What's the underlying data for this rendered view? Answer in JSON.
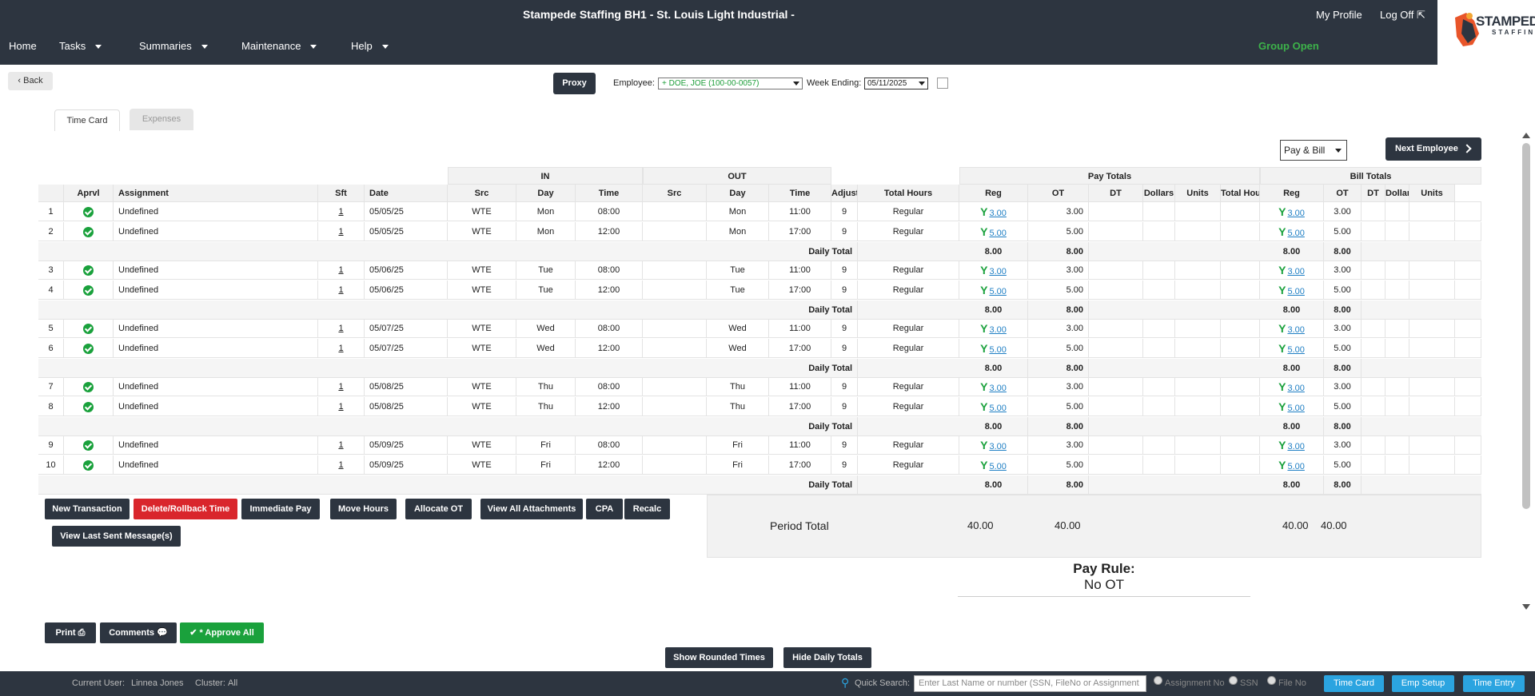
{
  "header": {
    "title": "Stampede Staffing BH1 - St. Louis Light Industrial -",
    "my_profile": "My Profile",
    "log_off": "Log Off",
    "logo_text": "STAMPEDE",
    "logo_sub": "STAFFING",
    "group_status": "Group Open",
    "nav": [
      "Home",
      "Tasks",
      "Summaries",
      "Maintenance",
      "Help"
    ]
  },
  "toolbar": {
    "back": "‹ Back",
    "proxy": "Proxy",
    "employee_label": "Employee:",
    "employee_value": "+  DOE, JOE (100-00-0057)",
    "week_label": "Week Ending:",
    "week_value": "05/11/2025"
  },
  "tabs": [
    "Time Card",
    "Expenses"
  ],
  "pay_bill_select": "Pay & Bill",
  "next_employee": "Next Employee",
  "table": {
    "group_headers": {
      "in": "IN",
      "out": "OUT",
      "pay_totals": "Pay Totals",
      "bill_totals": "Bill Totals"
    },
    "headers": [
      "",
      "Aprvl",
      "Assignment",
      "Sft",
      "Date",
      "Src",
      "Day",
      "Time",
      "Src",
      "Day",
      "Time",
      "Adjustment",
      "Total Hours",
      "Reg",
      "OT",
      "DT",
      "Dollars",
      "Units",
      "Total Hours",
      "Reg",
      "OT",
      "DT",
      "Dollars",
      "Units"
    ],
    "rows": [
      {
        "n": "1",
        "assign": "Undefined",
        "sft": "1",
        "date": "05/05/25",
        "in_src": "WTE",
        "in_day": "Mon",
        "in_time": "08:00",
        "out_src": "",
        "out_day": "Mon",
        "out_time": "11:00",
        "code": "9",
        "adj": "Regular",
        "pay_total": "3.00",
        "pay_reg": "3.00",
        "bill_total": "3.00",
        "bill_reg": "3.00"
      },
      {
        "n": "2",
        "assign": "Undefined",
        "sft": "1",
        "date": "05/05/25",
        "in_src": "WTE",
        "in_day": "Mon",
        "in_time": "12:00",
        "out_src": "",
        "out_day": "Mon",
        "out_time": "17:00",
        "code": "9",
        "adj": "Regular",
        "pay_total": "5.00",
        "pay_reg": "5.00",
        "bill_total": "5.00",
        "bill_reg": "5.00"
      },
      {
        "n": "3",
        "assign": "Undefined",
        "sft": "1",
        "date": "05/06/25",
        "in_src": "WTE",
        "in_day": "Tue",
        "in_time": "08:00",
        "out_src": "",
        "out_day": "Tue",
        "out_time": "11:00",
        "code": "9",
        "adj": "Regular",
        "pay_total": "3.00",
        "pay_reg": "3.00",
        "bill_total": "3.00",
        "bill_reg": "3.00"
      },
      {
        "n": "4",
        "assign": "Undefined",
        "sft": "1",
        "date": "05/06/25",
        "in_src": "WTE",
        "in_day": "Tue",
        "in_time": "12:00",
        "out_src": "",
        "out_day": "Tue",
        "out_time": "17:00",
        "code": "9",
        "adj": "Regular",
        "pay_total": "5.00",
        "pay_reg": "5.00",
        "bill_total": "5.00",
        "bill_reg": "5.00"
      },
      {
        "n": "5",
        "assign": "Undefined",
        "sft": "1",
        "date": "05/07/25",
        "in_src": "WTE",
        "in_day": "Wed",
        "in_time": "08:00",
        "out_src": "",
        "out_day": "Wed",
        "out_time": "11:00",
        "code": "9",
        "adj": "Regular",
        "pay_total": "3.00",
        "pay_reg": "3.00",
        "bill_total": "3.00",
        "bill_reg": "3.00"
      },
      {
        "n": "6",
        "assign": "Undefined",
        "sft": "1",
        "date": "05/07/25",
        "in_src": "WTE",
        "in_day": "Wed",
        "in_time": "12:00",
        "out_src": "",
        "out_day": "Wed",
        "out_time": "17:00",
        "code": "9",
        "adj": "Regular",
        "pay_total": "5.00",
        "pay_reg": "5.00",
        "bill_total": "5.00",
        "bill_reg": "5.00"
      },
      {
        "n": "7",
        "assign": "Undefined",
        "sft": "1",
        "date": "05/08/25",
        "in_src": "WTE",
        "in_day": "Thu",
        "in_time": "08:00",
        "out_src": "",
        "out_day": "Thu",
        "out_time": "11:00",
        "code": "9",
        "adj": "Regular",
        "pay_total": "3.00",
        "pay_reg": "3.00",
        "bill_total": "3.00",
        "bill_reg": "3.00"
      },
      {
        "n": "8",
        "assign": "Undefined",
        "sft": "1",
        "date": "05/08/25",
        "in_src": "WTE",
        "in_day": "Thu",
        "in_time": "12:00",
        "out_src": "",
        "out_day": "Thu",
        "out_time": "17:00",
        "code": "9",
        "adj": "Regular",
        "pay_total": "5.00",
        "pay_reg": "5.00",
        "bill_total": "5.00",
        "bill_reg": "5.00"
      },
      {
        "n": "9",
        "assign": "Undefined",
        "sft": "1",
        "date": "05/09/25",
        "in_src": "WTE",
        "in_day": "Fri",
        "in_time": "08:00",
        "out_src": "",
        "out_day": "Fri",
        "out_time": "11:00",
        "code": "9",
        "adj": "Regular",
        "pay_total": "3.00",
        "pay_reg": "3.00",
        "bill_total": "3.00",
        "bill_reg": "3.00"
      },
      {
        "n": "10",
        "assign": "Undefined",
        "sft": "1",
        "date": "05/09/25",
        "in_src": "WTE",
        "in_day": "Fri",
        "in_time": "12:00",
        "out_src": "",
        "out_day": "Fri",
        "out_time": "17:00",
        "code": "9",
        "adj": "Regular",
        "pay_total": "5.00",
        "pay_reg": "5.00",
        "bill_total": "5.00",
        "bill_reg": "5.00"
      }
    ],
    "daily_total_label": "Daily Total",
    "daily_total": {
      "pay_total": "8.00",
      "pay_reg": "8.00",
      "bill_total": "8.00",
      "bill_reg": "8.00"
    },
    "period_total_label": "Period Total",
    "period_total": {
      "pay_total": "40.00",
      "pay_reg": "40.00",
      "bill_total": "40.00",
      "bill_reg": "40.00"
    }
  },
  "actions": [
    "New Transaction",
    "Delete/Rollback Time",
    "Immediate Pay",
    "Move Hours",
    "Allocate OT",
    "View All Attachments",
    "CPA",
    "Recalc",
    "View Last Sent Message(s)"
  ],
  "pay_rule": {
    "label": "Pay Rule:",
    "value": "No OT"
  },
  "bottom_actions": {
    "print": "Print",
    "comments": "Comments",
    "approve_all": "* Approve All",
    "show_rounded": "Show Rounded Times",
    "hide_daily": "Hide Daily Totals"
  },
  "footer": {
    "current_user_label": "Current User:",
    "current_user": "Linnea Jones",
    "cluster_label": "Cluster:",
    "cluster": "All",
    "quick_search_label": "Quick Search:",
    "quick_search_placeholder": "Enter Last Name or number (SSN, FileNo or Assignment",
    "radio_assignment": "Assignment No",
    "radio_ssn": "SSN",
    "radio_file": "File No",
    "btn_time_card": "Time Card",
    "btn_emp_setup": "Emp Setup",
    "btn_time_entry": "Time Entry"
  },
  "colors": {
    "header_bg": "#2d3540",
    "approve_green": "#1aa13c",
    "delete_red": "#d9262c",
    "link_blue": "#1f7fc4",
    "footer_button": "#2ba4e0"
  }
}
